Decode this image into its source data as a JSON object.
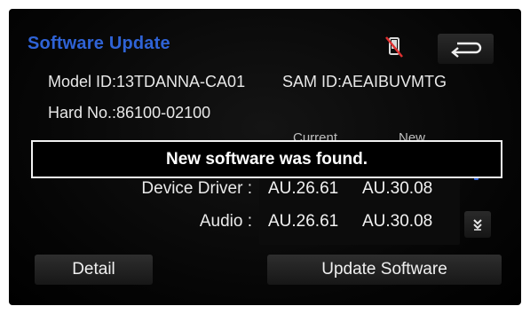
{
  "header": {
    "title": "Software Update",
    "status_icon": "phone-disconnected-icon",
    "back_icon": "back-arrow-icon"
  },
  "info": {
    "model_id": "Model ID:13TDANNA-CA01",
    "sam_id": "SAM ID:AEAIBUVMTG",
    "hard_no": "Hard No.:86100-02100"
  },
  "columns": {
    "current": "Current",
    "new": "New"
  },
  "toast": {
    "message": "New software was found."
  },
  "versions": [
    {
      "label": "Device Driver :",
      "current": "AU.26.61",
      "new": "AU.30.08"
    },
    {
      "label": "Audio :",
      "current": "AU.26.61",
      "new": "AU.30.08"
    }
  ],
  "buttons": {
    "detail": "Detail",
    "update": "Update Software",
    "scroll_down_icon": "scroll-down-icon"
  },
  "colors": {
    "title_blue": "#2f63d6",
    "background": "#000000",
    "text": "#e8e8e8"
  }
}
